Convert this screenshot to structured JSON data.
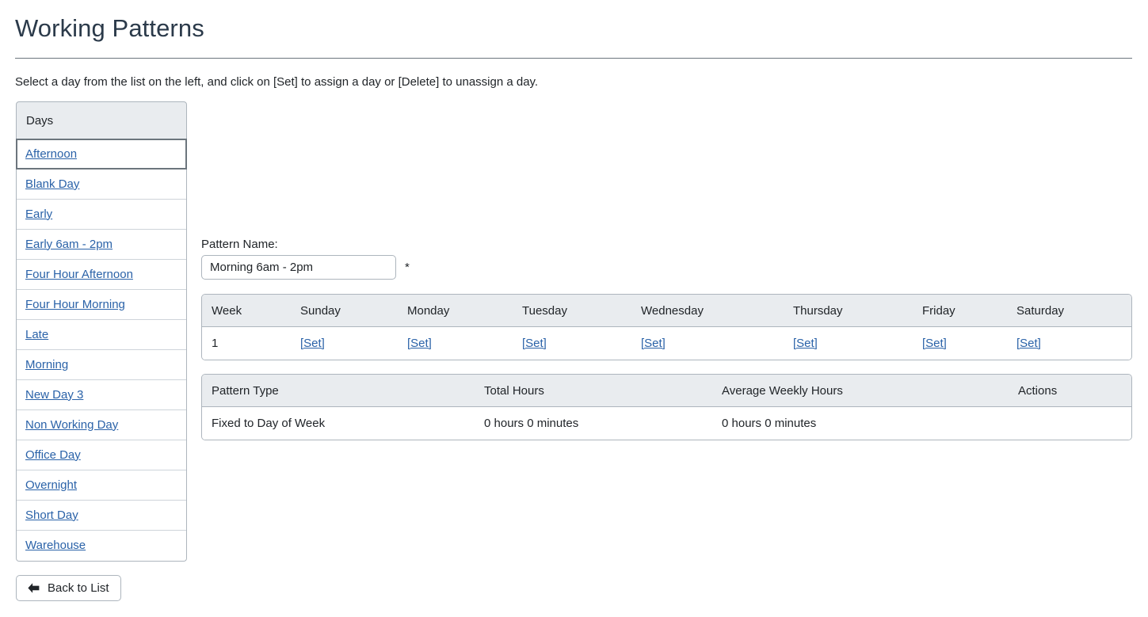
{
  "page": {
    "title": "Working Patterns",
    "instruction": "Select a day from the list on the left, and click on [Set] to assign a day or [Delete] to unassign a day."
  },
  "colors": {
    "link": "#2a62a8",
    "header_bg": "#e9ecef",
    "border": "#adb5bd",
    "title_text": "#2b3a4a",
    "body_text": "#212529"
  },
  "days_panel": {
    "header": "Days",
    "selected": "Afternoon",
    "items": [
      {
        "label": "Afternoon"
      },
      {
        "label": "Blank Day"
      },
      {
        "label": "Early"
      },
      {
        "label": "Early 6am - 2pm"
      },
      {
        "label": "Four Hour Afternoon"
      },
      {
        "label": "Four Hour Morning"
      },
      {
        "label": "Late"
      },
      {
        "label": "Morning"
      },
      {
        "label": "New Day 3"
      },
      {
        "label": "Non Working Day"
      },
      {
        "label": "Office Day"
      },
      {
        "label": "Overnight"
      },
      {
        "label": "Short Day"
      },
      {
        "label": "Warehouse"
      }
    ]
  },
  "back_button": {
    "label": "Back to List",
    "icon": "arrow-left-icon"
  },
  "pattern_name": {
    "label": "Pattern Name:",
    "value": "Morning 6am - 2pm",
    "placeholder": "",
    "required_mark": "*"
  },
  "week_table": {
    "headers": [
      "Week",
      "Sunday",
      "Monday",
      "Tuesday",
      "Wednesday",
      "Thursday",
      "Friday",
      "Saturday"
    ],
    "rows": [
      {
        "week": "1",
        "sunday": "[Set]",
        "monday": "[Set]",
        "tuesday": "[Set]",
        "wednesday": "[Set]",
        "thursday": "[Set]",
        "friday": "[Set]",
        "saturday": "[Set]"
      }
    ]
  },
  "summary_table": {
    "headers": [
      "Pattern Type",
      "Total Hours",
      "Average Weekly Hours",
      "Actions"
    ],
    "rows": [
      {
        "pattern_type": "Fixed to Day of Week",
        "total_hours": "0 hours 0 minutes",
        "average_weekly_hours": "0 hours 0 minutes",
        "actions": ""
      }
    ]
  }
}
